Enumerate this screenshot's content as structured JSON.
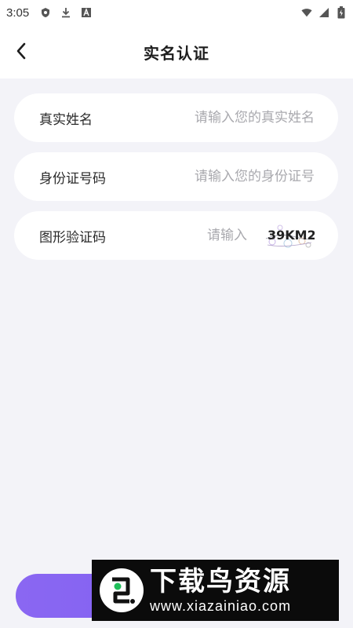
{
  "status_bar": {
    "time": "3:05",
    "icons": [
      "shield-app-icon",
      "download-icon",
      "font-app-icon",
      "wifi-icon",
      "signal-icon",
      "battery-icon"
    ]
  },
  "header": {
    "title": "实名认证",
    "back_icon": "chevron-left-icon"
  },
  "form": {
    "name_label": "真实姓名",
    "name_placeholder": "请输入您的真实姓名",
    "name_value": "",
    "id_label": "身份证号码",
    "id_placeholder": "请输入您的身份证号",
    "id_value": "",
    "captcha_label": "图形验证码",
    "captcha_placeholder": "请输入",
    "captcha_value": "",
    "captcha_image_text": "39KM2"
  },
  "submit": {
    "label": ""
  },
  "watermark": {
    "title": "下载鸟资源",
    "url": "www.xiazainiao.com"
  },
  "colors": {
    "page_bg": "#f3f3f8",
    "accent": "#7b5cf0",
    "placeholder": "#a9a9ae"
  }
}
